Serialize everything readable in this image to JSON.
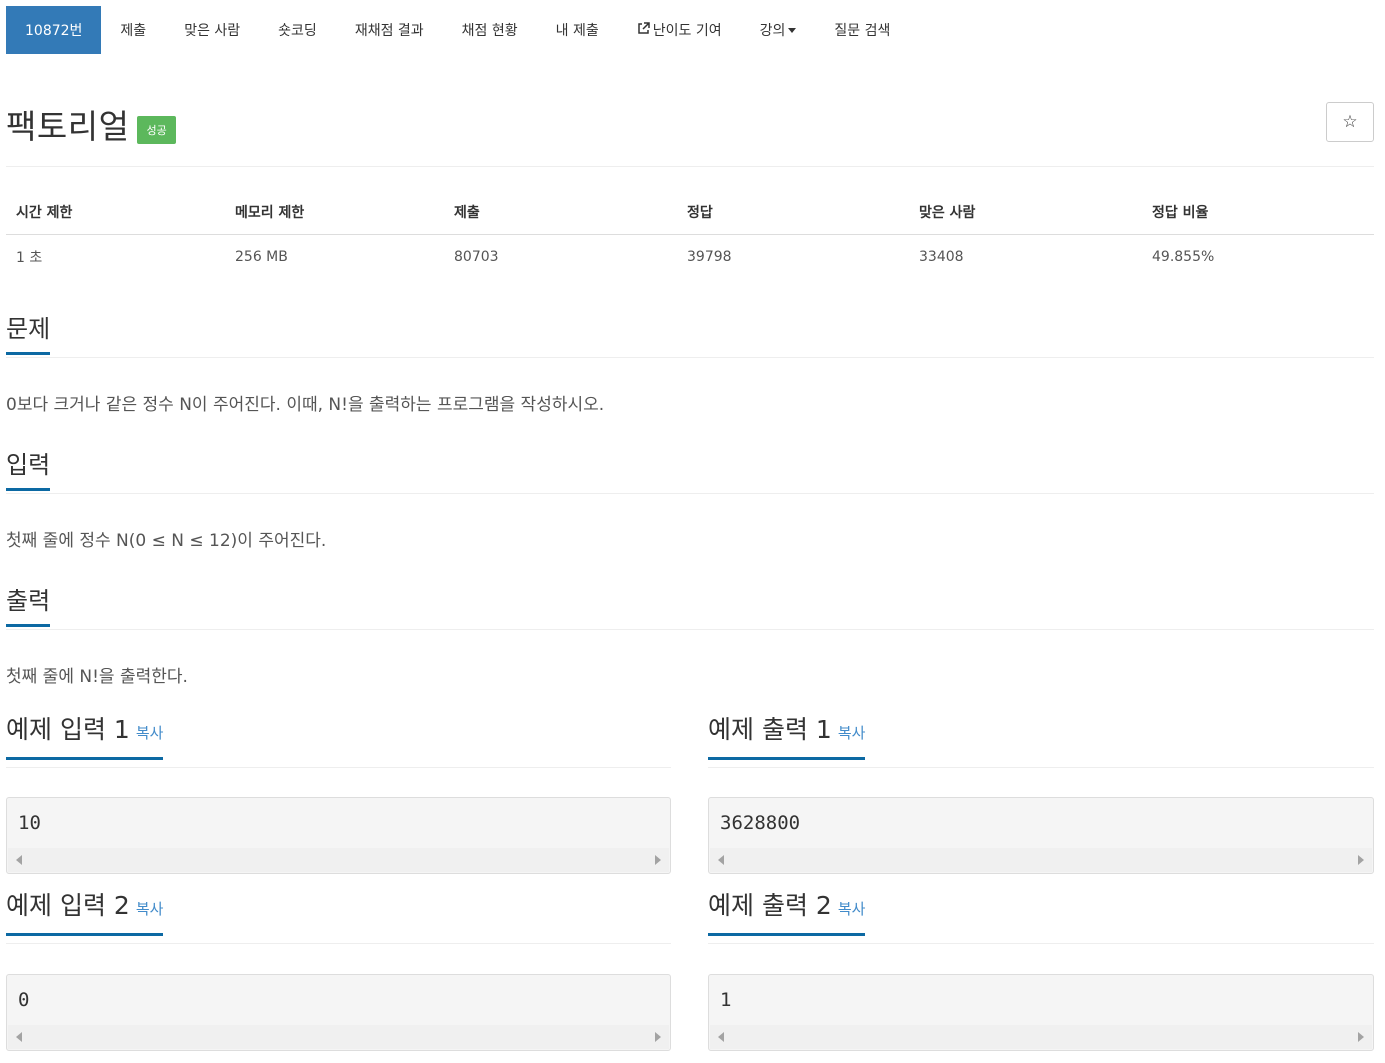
{
  "nav": {
    "items": [
      {
        "label": "10872번",
        "active": true
      },
      {
        "label": "제출"
      },
      {
        "label": "맞은 사람"
      },
      {
        "label": "숏코딩"
      },
      {
        "label": "재채점 결과"
      },
      {
        "label": "채점 현황"
      },
      {
        "label": "내 제출"
      },
      {
        "label": "난이도 기여",
        "icon": "external-link-icon"
      },
      {
        "label": "강의",
        "icon": "caret-down-icon"
      },
      {
        "label": "질문 검색"
      }
    ]
  },
  "title": {
    "text": "팩토리얼",
    "badge": "성공",
    "star": "☆"
  },
  "info": {
    "headers": [
      "시간 제한",
      "메모리 제한",
      "제출",
      "정답",
      "맞은 사람",
      "정답 비율"
    ],
    "values": [
      "1 초",
      "256 MB",
      "80703",
      "39798",
      "33408",
      "49.855%"
    ]
  },
  "sections": {
    "problem": {
      "title": "문제",
      "text": "0보다 크거나 같은 정수 N이 주어진다. 이때, N!을 출력하는 프로그램을 작성하시오."
    },
    "input": {
      "title": "입력",
      "text": "첫째 줄에 정수 N(0 ≤ N ≤ 12)이 주어진다."
    },
    "output": {
      "title": "출력",
      "text": "첫째 줄에 N!을 출력한다."
    }
  },
  "samples": {
    "copy_label": "복사",
    "input1": {
      "title": "예제 입력 1",
      "value": "10"
    },
    "output1": {
      "title": "예제 출력 1",
      "value": "3628800"
    },
    "input2": {
      "title": "예제 입력 2",
      "value": "0"
    },
    "output2": {
      "title": "예제 출력 2",
      "value": "1"
    }
  },
  "colors": {
    "accent": "#337ab7",
    "success": "#5cb85c",
    "underline": "#0c69a3",
    "link": "#428bca"
  }
}
